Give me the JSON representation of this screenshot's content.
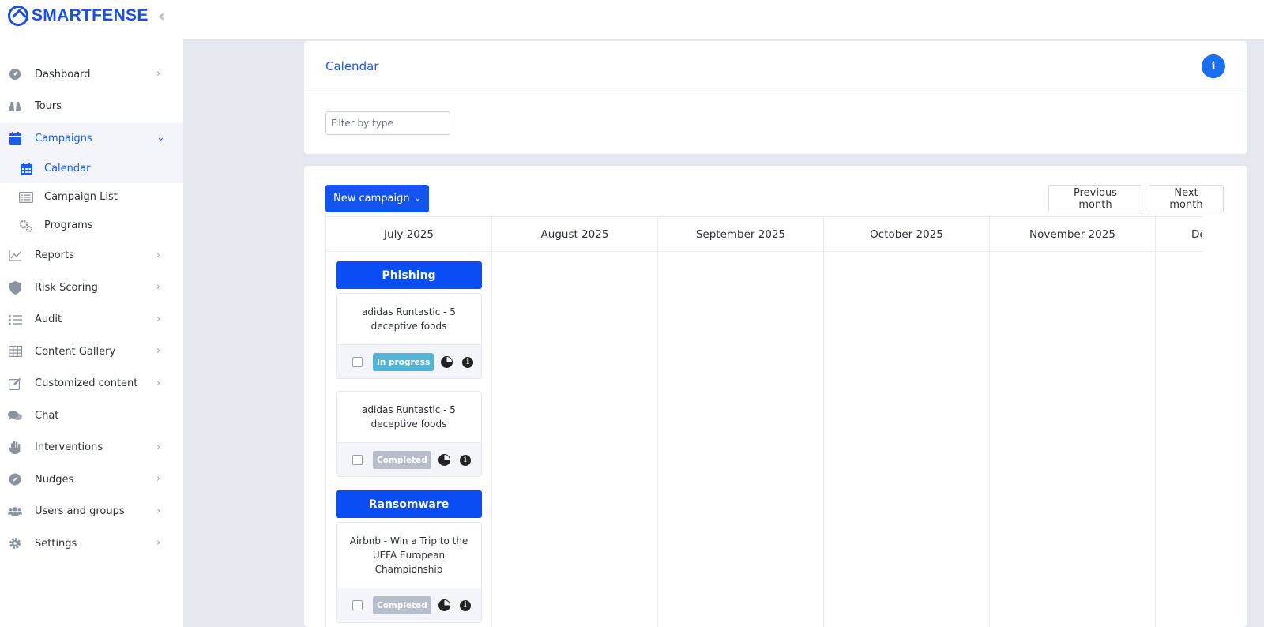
{
  "brand": {
    "name": "SMARTFENSE"
  },
  "sidebar": {
    "items": [
      {
        "label": "Dashboard",
        "icon": "gauge-icon",
        "chevron": "›"
      },
      {
        "label": "Tours",
        "icon": "binoculars-icon",
        "chevron": ""
      },
      {
        "label": "Campaigns",
        "icon": "calendar-icon",
        "chevron": "⌄",
        "active": true
      },
      {
        "label": "Calendar",
        "icon": "calendar-grid-icon",
        "sub": true,
        "active": true
      },
      {
        "label": "Campaign List",
        "icon": "list-icon",
        "sub": true
      },
      {
        "label": "Programs",
        "icon": "gears-icon",
        "sub": true
      },
      {
        "label": "Reports",
        "icon": "line-chart-icon",
        "chevron": "›"
      },
      {
        "label": "Risk Scoring",
        "icon": "shield-icon",
        "chevron": "›"
      },
      {
        "label": "Audit",
        "icon": "list-bullets-icon",
        "chevron": "›"
      },
      {
        "label": "Content Gallery",
        "icon": "table-icon",
        "chevron": "›"
      },
      {
        "label": "Customized content",
        "icon": "edit-icon",
        "chevron": "›"
      },
      {
        "label": "Chat",
        "icon": "chat-icon",
        "chevron": ""
      },
      {
        "label": "Interventions",
        "icon": "hand-icon",
        "chevron": "›"
      },
      {
        "label": "Nudges",
        "icon": "compass-icon",
        "chevron": "›"
      },
      {
        "label": "Users and groups",
        "icon": "users-icon",
        "chevron": "›"
      },
      {
        "label": "Settings",
        "icon": "gear-icon",
        "chevron": "›"
      }
    ]
  },
  "calendar_card": {
    "title": "Calendar",
    "info": "i",
    "filter_placeholder": "Filter by type"
  },
  "toolbar": {
    "new_campaign": "New campaign",
    "previous_month": "Previous month",
    "next_month": "Next month"
  },
  "months": [
    "July 2025",
    "August 2025",
    "September 2025",
    "October 2025",
    "November 2025",
    "De"
  ],
  "july": {
    "phishing_label": "Phishing",
    "ransomware_label": "Ransomware",
    "campaigns": [
      {
        "title": "adidas Runtastic - 5 deceptive foods",
        "status": "In progress"
      },
      {
        "title": "adidas Runtastic - 5 deceptive foods",
        "status": "Completed"
      },
      {
        "title": "Airbnb - Win a Trip to the UEFA European Championship",
        "status": "Completed"
      }
    ]
  },
  "colors": {
    "brand": "#1a4fe0",
    "accent": "#1354f0",
    "in_progress": "#55b3d6",
    "completed": "#b7bec9"
  }
}
